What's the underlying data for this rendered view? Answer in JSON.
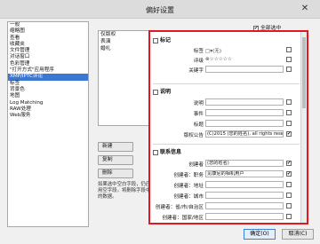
{
  "window": {
    "title": "偏好设置",
    "close_glyph": "✕"
  },
  "categories": [
    "一般",
    "缩略图",
    "查看",
    "收藏夹",
    "文件管理",
    "对话窗口",
    "色彩管理",
    "\"打开方式\"应用程序",
    "XMP/IPTC评论",
    "标签",
    "背景色",
    "地图",
    "Log Matching",
    "RAW处理",
    "Web服务"
  ],
  "selected_category_index": 8,
  "presets": [
    "仅版权",
    "表演",
    "婚礼"
  ],
  "buttons": {
    "new": "新建",
    "copy": "复制",
    "delete": "删除",
    "ok": "确定(O)",
    "cancel": "取消(C)"
  },
  "hint": "如果选中空白字段，仍应用空字段。将删除字段中的数据。",
  "select_all": {
    "label": "全部选中",
    "checked": "✔"
  },
  "sections": {
    "marks": {
      "title": "标记"
    },
    "description": {
      "title": "说明"
    },
    "contact": {
      "title": "联系信息"
    }
  },
  "marks_rows": {
    "label": {
      "name": "标签",
      "value": "□▾(无)"
    },
    "rating": {
      "name": "评级",
      "value": "⊗☆☆☆☆☆"
    },
    "keyword": {
      "name": "关键字",
      "value": ""
    }
  },
  "description_rows": {
    "description": {
      "name": "说明",
      "value": ""
    },
    "event": {
      "name": "事件",
      "value": ""
    },
    "title": {
      "name": "标题",
      "value": ""
    },
    "copyright": {
      "name": "版权公告",
      "value": "(C)2015 (您的姓名), all rights reser",
      "checked": "✔"
    }
  },
  "contact_rows": {
    "creator": {
      "name": "创建者",
      "value": "(您的姓名)",
      "checked": "✔"
    },
    "job": {
      "name": "创建者：职务",
      "value": "见康尼的相机用户",
      "checked": "✔"
    },
    "address": {
      "name": "创建者：地址",
      "value": ""
    },
    "city": {
      "name": "创建者：城市",
      "value": ""
    },
    "state": {
      "name": "创建者：省/市/自治区",
      "value": ""
    },
    "country": {
      "name": "创建者：国家/地区",
      "value": ""
    }
  }
}
